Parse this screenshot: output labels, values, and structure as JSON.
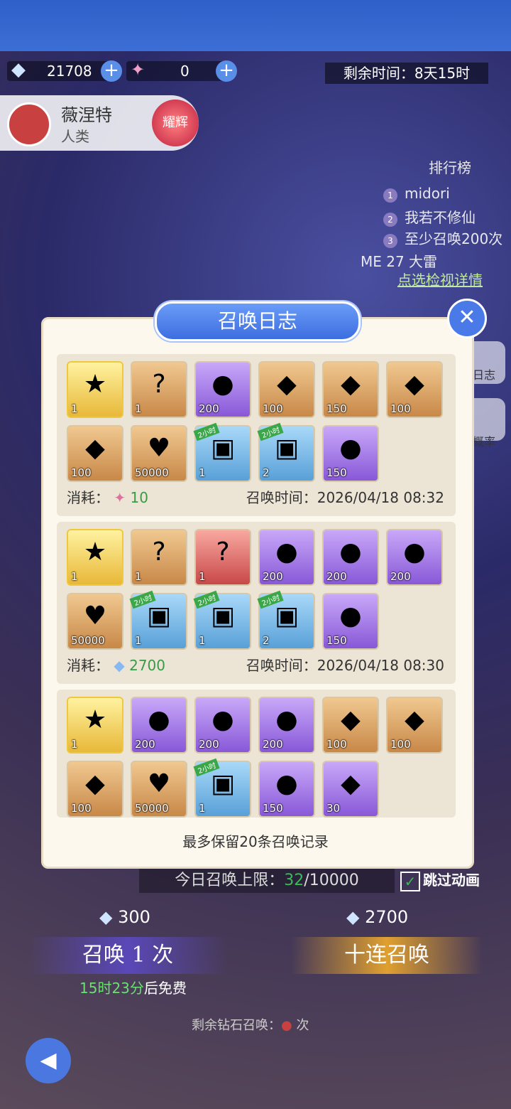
{
  "resources": {
    "diamond": "21708",
    "ticket": "0",
    "plus": "+"
  },
  "timer": "剩余时间：8天15时",
  "character": {
    "name": "薇涅特",
    "race": "人类",
    "badge": "耀辉"
  },
  "ranking": {
    "title": "排行榜",
    "rows": [
      {
        "num": "1",
        "name": "midori"
      },
      {
        "num": "2",
        "name": "我若不修仙"
      },
      {
        "num": "3",
        "name": "至少召唤200次"
      }
    ],
    "me": "ME 27    大雷",
    "detail": "点选检视详情"
  },
  "side": {
    "log": "日志",
    "rate": "概率"
  },
  "modal": {
    "title": "召唤日志",
    "close": "✕",
    "consume_label": "消耗：",
    "time_label": "召唤时间：",
    "note": "最多保留20条召唤记录",
    "records": [
      {
        "consume": "10",
        "time": "2026/04/18 08:32",
        "items": [
          {
            "q": "gold",
            "glyph": "★",
            "count": "1",
            "icon": "hero-portrait"
          },
          {
            "q": "orange",
            "glyph": "?",
            "count": "1",
            "icon": "mystery-box"
          },
          {
            "q": "purple",
            "glyph": "●",
            "count": "200",
            "icon": "crystal-orb"
          },
          {
            "q": "orange",
            "glyph": "◆",
            "count": "100",
            "icon": "diamond"
          },
          {
            "q": "orange",
            "glyph": "◆",
            "count": "150",
            "icon": "diamond"
          },
          {
            "q": "orange",
            "glyph": "◆",
            "count": "100",
            "icon": "diamond"
          },
          {
            "q": "orange",
            "glyph": "◆",
            "count": "100",
            "icon": "diamond"
          },
          {
            "q": "orange",
            "glyph": "♥",
            "count": "50000",
            "icon": "exp-heart"
          },
          {
            "q": "blue",
            "glyph": "▣",
            "count": "1",
            "icon": "treasure-chest",
            "tag": "2小时"
          },
          {
            "q": "blue",
            "glyph": "▣",
            "count": "2",
            "icon": "gold-chest",
            "tag": "2小时"
          },
          {
            "q": "purple",
            "glyph": "●",
            "count": "150",
            "icon": "golden-egg"
          }
        ]
      },
      {
        "consume": "2700",
        "time": "2026/04/18 08:30",
        "items": [
          {
            "q": "gold",
            "glyph": "★",
            "count": "1",
            "icon": "hero-portrait"
          },
          {
            "q": "orange",
            "glyph": "?",
            "count": "1",
            "icon": "mystery-box"
          },
          {
            "q": "red",
            "glyph": "?",
            "count": "1",
            "icon": "mystery-box"
          },
          {
            "q": "purple",
            "glyph": "●",
            "count": "200",
            "icon": "crystal-orb"
          },
          {
            "q": "purple",
            "glyph": "●",
            "count": "200",
            "icon": "crystal-orb"
          },
          {
            "q": "purple",
            "glyph": "●",
            "count": "200",
            "icon": "crystal-orb"
          },
          {
            "q": "orange",
            "glyph": "♥",
            "count": "50000",
            "icon": "exp-heart"
          },
          {
            "q": "blue",
            "glyph": "▣",
            "count": "1",
            "icon": "treasure-chest",
            "tag": "2小时"
          },
          {
            "q": "blue",
            "glyph": "▣",
            "count": "1",
            "icon": "treasure-chest",
            "tag": "2小时"
          },
          {
            "q": "blue",
            "glyph": "▣",
            "count": "2",
            "icon": "gold-chest",
            "tag": "2小时"
          },
          {
            "q": "purple",
            "glyph": "●",
            "count": "150",
            "icon": "golden-egg"
          }
        ]
      },
      {
        "items": [
          {
            "q": "gold",
            "glyph": "★",
            "count": "1",
            "icon": "hero-portrait"
          },
          {
            "q": "purple",
            "glyph": "●",
            "count": "200",
            "icon": "crystal-orb"
          },
          {
            "q": "purple",
            "glyph": "●",
            "count": "200",
            "icon": "crystal-orb"
          },
          {
            "q": "purple",
            "glyph": "●",
            "count": "200",
            "icon": "crystal-orb"
          },
          {
            "q": "orange",
            "glyph": "◆",
            "count": "100",
            "icon": "diamond"
          },
          {
            "q": "orange",
            "glyph": "◆",
            "count": "100",
            "icon": "diamond"
          },
          {
            "q": "orange",
            "glyph": "◆",
            "count": "100",
            "icon": "diamond"
          },
          {
            "q": "orange",
            "glyph": "♥",
            "count": "50000",
            "icon": "exp-heart"
          },
          {
            "q": "blue",
            "glyph": "▣",
            "count": "1",
            "icon": "treasure-chest",
            "tag": "2小时"
          },
          {
            "q": "purple",
            "glyph": "●",
            "count": "150",
            "icon": "golden-egg"
          },
          {
            "q": "purple",
            "glyph": "◆",
            "count": "30",
            "icon": "purple-crystal"
          }
        ]
      }
    ]
  },
  "limit": {
    "label": "今日召唤上限：",
    "used": "32",
    "total": "/10000"
  },
  "skip": "跳过动画",
  "summon": {
    "cost1": "300",
    "cost10": "2700",
    "btn1": "召唤 1 次",
    "btn10": "十连召唤",
    "free_time": "15时23分",
    "free_suffix": "后免费",
    "remain_label": "剩余钻石召唤：",
    "remain_suffix": "次"
  }
}
